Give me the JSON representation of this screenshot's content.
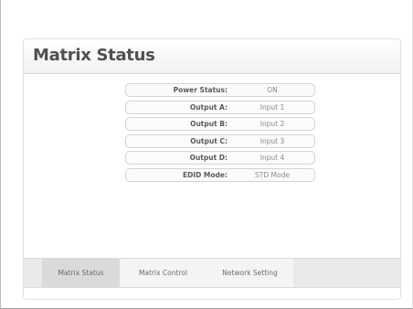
{
  "panel": {
    "title": "Matrix Status"
  },
  "status_rows": [
    {
      "label": "Power Status:",
      "value": "ON"
    },
    {
      "label": "Output A:",
      "value": "Input 1"
    },
    {
      "label": "Output B:",
      "value": "Input 2"
    },
    {
      "label": "Output C:",
      "value": "Input 3"
    },
    {
      "label": "Output D:",
      "value": "Input 4"
    },
    {
      "label": "EDID Mode:",
      "value": "STD Mode"
    }
  ],
  "tabs": [
    {
      "label": "Matrix Status",
      "active": true
    },
    {
      "label": "Matrix Control",
      "active": false
    },
    {
      "label": "Network Setting",
      "active": false
    }
  ]
}
